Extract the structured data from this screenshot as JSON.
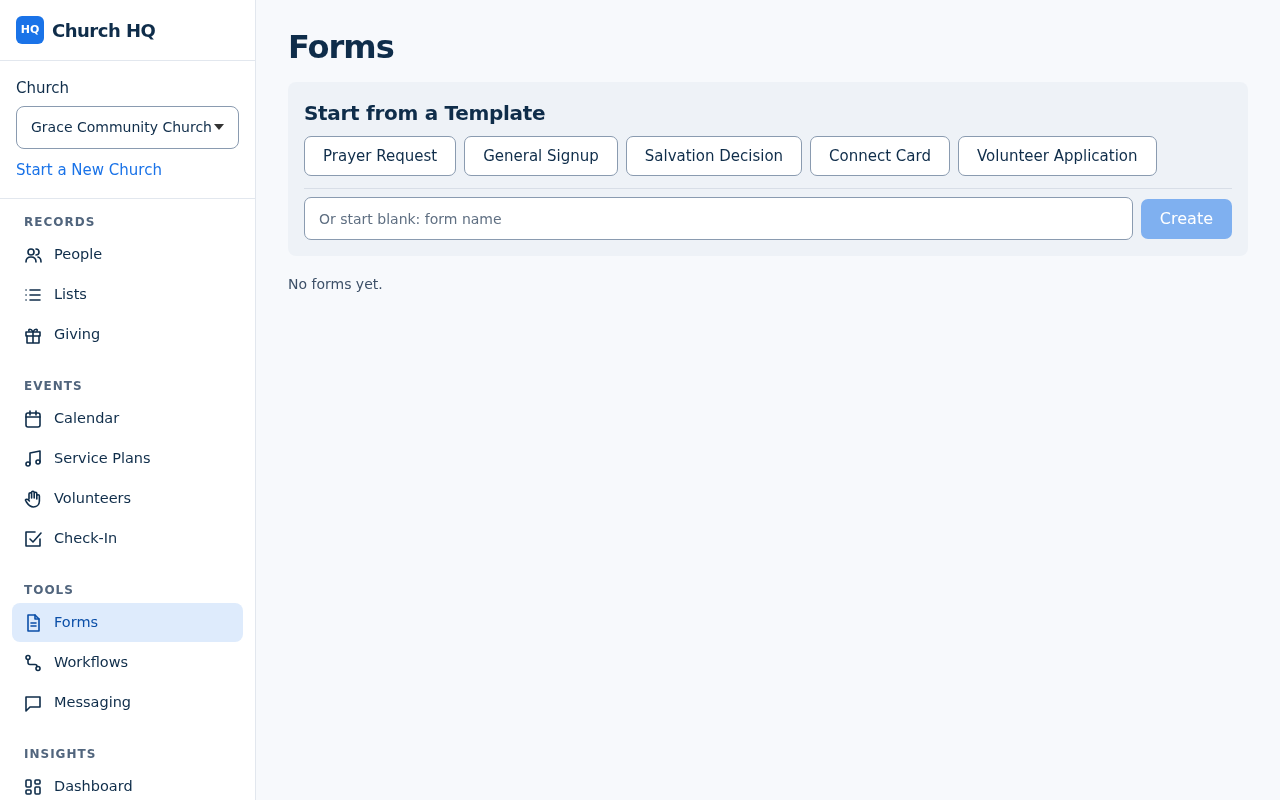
{
  "brand": {
    "logo": "HQ",
    "name": "Church HQ"
  },
  "church": {
    "label": "Church",
    "value": "Grace Community Church",
    "link": "Start a New Church"
  },
  "sidebar": {
    "sections": [
      {
        "title": "RECORDS",
        "items": [
          {
            "label": "People",
            "kind": "people",
            "selected": false
          },
          {
            "label": "Lists",
            "kind": "list",
            "selected": false
          },
          {
            "label": "Giving",
            "kind": "gift",
            "selected": false
          }
        ]
      },
      {
        "title": "EVENTS",
        "items": [
          {
            "label": "Calendar",
            "kind": "calendar",
            "selected": false
          },
          {
            "label": "Service Plans",
            "kind": "music",
            "selected": false
          },
          {
            "label": "Volunteers",
            "kind": "hand",
            "selected": false
          },
          {
            "label": "Check-In",
            "kind": "check",
            "selected": false
          }
        ]
      },
      {
        "title": "TOOLS",
        "items": [
          {
            "label": "Forms",
            "kind": "file",
            "selected": true
          },
          {
            "label": "Workflows",
            "kind": "route",
            "selected": false
          },
          {
            "label": "Messaging",
            "kind": "chat",
            "selected": false
          }
        ]
      },
      {
        "title": "INSIGHTS",
        "items": [
          {
            "label": "Dashboard",
            "kind": "grid",
            "selected": false
          }
        ]
      }
    ]
  },
  "page": {
    "title": "Forms",
    "templates": {
      "title": "Start from a Template",
      "buttons": [
        "Prayer Request",
        "General Signup",
        "Salvation Decision",
        "Connect Card",
        "Volunteer Application"
      ],
      "blank": {
        "placeholder": "Or start blank: form name"
      },
      "create": {
        "label": "Create",
        "disabled": true
      }
    },
    "empty": "No forms yet."
  }
}
